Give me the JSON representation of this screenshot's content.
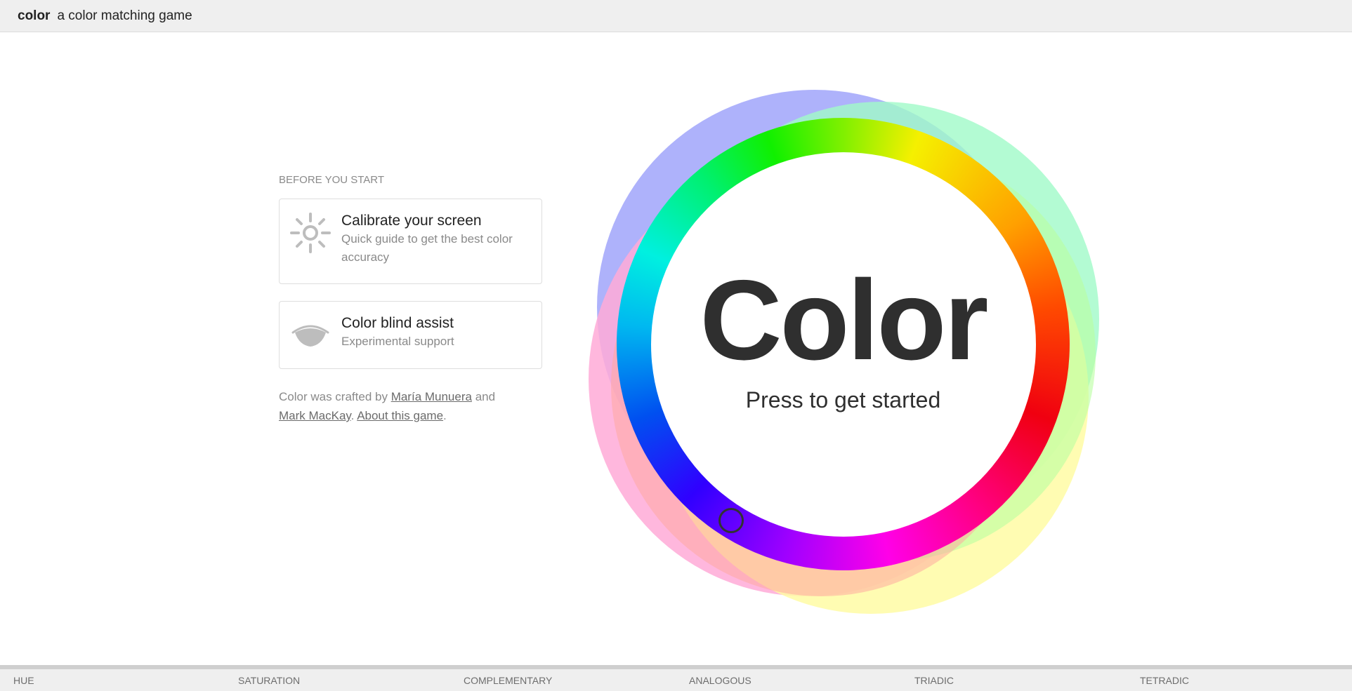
{
  "header": {
    "brand": "color",
    "tagline": "a color matching game"
  },
  "intro": {
    "heading": "BEFORE YOU START",
    "cards": [
      {
        "title": "Calibrate your screen",
        "subtitle": "Quick guide to get the best color accuracy",
        "icon": "sun-icon"
      },
      {
        "title": "Color blind assist",
        "subtitle": "Experimental support",
        "icon": "eye-icon"
      }
    ],
    "credits": {
      "prefix": "Color was crafted by",
      "author1": "María Munuera",
      "and": "and",
      "author2": "Mark MacKay",
      "sep": ".",
      "about": "About this game",
      "end": "."
    }
  },
  "wheel": {
    "title": "Color",
    "prompt": "Press to get started"
  },
  "footer": {
    "tabs": [
      "HUE",
      "SATURATION",
      "COMPLEMENTARY",
      "ANALOGOUS",
      "TRIADIC",
      "TETRADIC"
    ]
  },
  "colors": {
    "header_bg": "#efefef",
    "card_border": "#dedede",
    "muted_text": "#8a8a8a",
    "title_text": "#2f2f2f"
  }
}
